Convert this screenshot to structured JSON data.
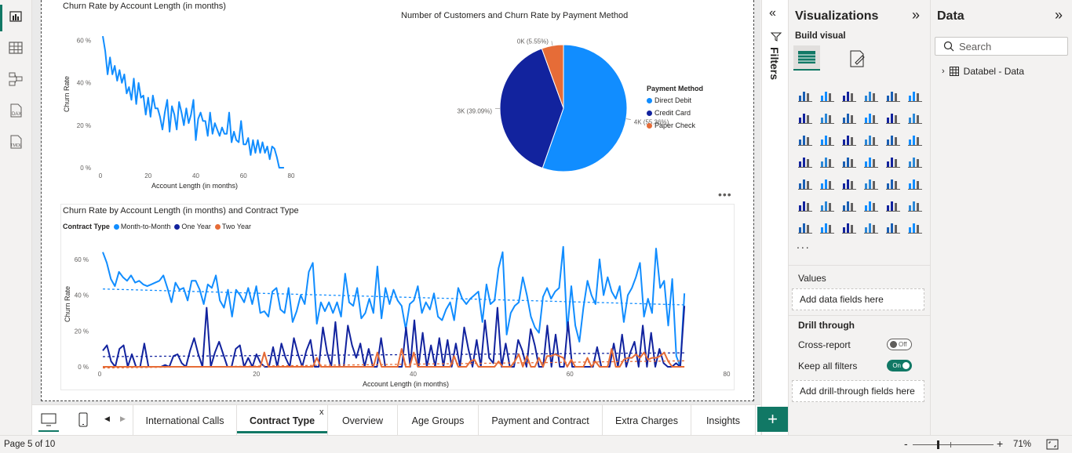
{
  "report": {
    "chart1_title": "Churn Rate by Account Length (in months)",
    "chart2_title": "Number of Customers and Churn Rate by Payment Method",
    "chart3_title": "Churn Rate by Account Length (in months) and Contract Type"
  },
  "chart_data": [
    {
      "type": "line",
      "title": "Churn Rate by Account Length (in months)",
      "xlabel": "Account Length (in months)",
      "ylabel": "Churn Rate",
      "x_ticks": [
        "0",
        "20",
        "40",
        "60",
        "80"
      ],
      "y_ticks": [
        "0 %",
        "20 %",
        "40 %",
        "60 %"
      ],
      "xlim": [
        0,
        80
      ],
      "ylim": [
        0,
        65
      ],
      "series": [
        {
          "values": [
            [
              1,
              62
            ],
            [
              2,
              55
            ],
            [
              3,
              44
            ],
            [
              4,
              52
            ],
            [
              5,
              44
            ],
            [
              6,
              48
            ],
            [
              7,
              41
            ],
            [
              8,
              46
            ],
            [
              9,
              40
            ],
            [
              10,
              44
            ],
            [
              11,
              35
            ],
            [
              12,
              38
            ],
            [
              13,
              32
            ],
            [
              14,
              42
            ],
            [
              15,
              30
            ],
            [
              16,
              40
            ],
            [
              17,
              33
            ],
            [
              18,
              34
            ],
            [
              19,
              25
            ],
            [
              20,
              33
            ],
            [
              21,
              24
            ],
            [
              22,
              34
            ],
            [
              23,
              28
            ],
            [
              24,
              28
            ],
            [
              25,
              24
            ],
            [
              26,
              18
            ],
            [
              27,
              26
            ],
            [
              28,
              32
            ],
            [
              29,
              17
            ],
            [
              30,
              29
            ],
            [
              31,
              25
            ],
            [
              32,
              18
            ],
            [
              33,
              31
            ],
            [
              34,
              26
            ],
            [
              35,
              20
            ],
            [
              36,
              28
            ],
            [
              37,
              21
            ],
            [
              38,
              25
            ],
            [
              39,
              32
            ],
            [
              40,
              13
            ],
            [
              41,
              23
            ],
            [
              42,
              26
            ],
            [
              43,
              22
            ],
            [
              44,
              22
            ],
            [
              45,
              15
            ],
            [
              46,
              26
            ],
            [
              47,
              16
            ],
            [
              48,
              21
            ],
            [
              49,
              18
            ],
            [
              50,
              15
            ],
            [
              51,
              19
            ],
            [
              52,
              16
            ],
            [
              53,
              16
            ],
            [
              54,
              26
            ],
            [
              55,
              12
            ],
            [
              56,
              17
            ],
            [
              57,
              13
            ],
            [
              58,
              12
            ],
            [
              59,
              22
            ],
            [
              60,
              11
            ],
            [
              61,
              11
            ],
            [
              62,
              14
            ],
            [
              63,
              6
            ],
            [
              64,
              13
            ],
            [
              65,
              7
            ],
            [
              66,
              13
            ],
            [
              67,
              7
            ],
            [
              68,
              12
            ],
            [
              69,
              7
            ],
            [
              70,
              10
            ],
            [
              71,
              4
            ],
            [
              72,
              10
            ],
            [
              73,
              9
            ],
            [
              74,
              5
            ],
            [
              75,
              0
            ],
            [
              76,
              0
            ],
            [
              77,
              0
            ]
          ]
        }
      ]
    },
    {
      "type": "pie",
      "title": "Number of Customers and Churn Rate by Payment Method",
      "legend_title": "Payment Method",
      "legend_position": "right",
      "slices": [
        {
          "label": "Direct Debit",
          "value": 55.36,
          "data_label": "4K (55.36%)",
          "color": "#118DFF"
        },
        {
          "label": "Credit Card",
          "value": 39.09,
          "data_label": "3K (39.09%)",
          "color": "#12239E"
        },
        {
          "label": "Paper Check",
          "value": 5.55,
          "data_label": "0K (5.55%)",
          "color": "#E66C37"
        }
      ]
    },
    {
      "type": "line",
      "title": "Churn Rate by Account Length (in months) and Contract Type",
      "legend_title": "Contract Type",
      "legend_position": "top-left",
      "xlabel": "Account Length (in months)",
      "ylabel": "Churn Rate",
      "x_ticks": [
        "0",
        "20",
        "40",
        "60",
        "80"
      ],
      "y_ticks": [
        "0 %",
        "20 %",
        "40 %",
        "60 %"
      ],
      "xlim": [
        0,
        80
      ],
      "ylim": [
        0,
        70
      ],
      "trend_lines": true,
      "series": [
        {
          "name": "Month-to-Month",
          "color": "#118DFF",
          "values": [
            64,
            58,
            49,
            45,
            53,
            50,
            48,
            51,
            47,
            48,
            46,
            45,
            46,
            47,
            48,
            51,
            44,
            36,
            47,
            43,
            44,
            37,
            48,
            48,
            43,
            35,
            46,
            44,
            51,
            37,
            33,
            43,
            28,
            43,
            40,
            36,
            44,
            35,
            45,
            30,
            31,
            28,
            42,
            44,
            32,
            30,
            44,
            25,
            31,
            40,
            35,
            53,
            58,
            24,
            36,
            31,
            36,
            30,
            36,
            28,
            52,
            36,
            34,
            44,
            27,
            30,
            38,
            30,
            56,
            27,
            44,
            35,
            43,
            37,
            34,
            21,
            35,
            37,
            45,
            30,
            36,
            32,
            41,
            28,
            26,
            32,
            36,
            26,
            44,
            38,
            35,
            38,
            40,
            42,
            25,
            46,
            35,
            37,
            55,
            64,
            18,
            30,
            34,
            36,
            50,
            40,
            28,
            22,
            19,
            39,
            44,
            38,
            42,
            44,
            67,
            20,
            45,
            23,
            14,
            33,
            48,
            40,
            35,
            60,
            40,
            50,
            42,
            38,
            45,
            25,
            40,
            44,
            50,
            58,
            28,
            38,
            30,
            66,
            44,
            48,
            23,
            49,
            6,
            0,
            41
          ]
        },
        {
          "name": "One Year",
          "color": "#12239E",
          "values": [
            9,
            12,
            3,
            0,
            10,
            12,
            0,
            7,
            0,
            0,
            13,
            0,
            0,
            0,
            0,
            1,
            0,
            6,
            7,
            2,
            0,
            9,
            16,
            7,
            0,
            33,
            0,
            8,
            14,
            7,
            0,
            0,
            10,
            12,
            0,
            5,
            0,
            7,
            2,
            0,
            0,
            11,
            0,
            13,
            5,
            0,
            16,
            7,
            0,
            9,
            15,
            0,
            0,
            22,
            8,
            0,
            25,
            0,
            0,
            23,
            12,
            5,
            13,
            0,
            10,
            0,
            0,
            16,
            0,
            0,
            0,
            0,
            0,
            22,
            0,
            26,
            0,
            19,
            0,
            12,
            0,
            16,
            0,
            15,
            0,
            13,
            0,
            22,
            10,
            0,
            15,
            0,
            26,
            5,
            2,
            33,
            0,
            13,
            0,
            0,
            15,
            9,
            0,
            21,
            12,
            0,
            0,
            23,
            0,
            18,
            0,
            0,
            25,
            0,
            0,
            0,
            0,
            0,
            0,
            11,
            0,
            0,
            0,
            13,
            0,
            18,
            0,
            8,
            14,
            0,
            23,
            0,
            19,
            0,
            10,
            2,
            0,
            0,
            2,
            0,
            34
          ]
        },
        {
          "name": "Two Year",
          "color": "#E66C37",
          "values": [
            0,
            0,
            0,
            0,
            0,
            0,
            0,
            0,
            0,
            0,
            0,
            0,
            0,
            0,
            0,
            0,
            0,
            0,
            0,
            0,
            0,
            0,
            0,
            0,
            0,
            0,
            0,
            0,
            0,
            0,
            0,
            0,
            0,
            0,
            0,
            0,
            0,
            0,
            0,
            0,
            8,
            0,
            0,
            0,
            0,
            0,
            0,
            0,
            0,
            0,
            0,
            0,
            0,
            5,
            0,
            0,
            0,
            0,
            0,
            0,
            0,
            0,
            0,
            0,
            0,
            0,
            0,
            0,
            8,
            0,
            0,
            0,
            0,
            0,
            10,
            0,
            0,
            8,
            0,
            0,
            0,
            0,
            0,
            0,
            0,
            0,
            0,
            6,
            0,
            0,
            0,
            3,
            4,
            0,
            0,
            0,
            0,
            0,
            3,
            0,
            0,
            0,
            3,
            7,
            0,
            6,
            0,
            0,
            5,
            0,
            6,
            6,
            7,
            6,
            5,
            0,
            4,
            0,
            0,
            0,
            5,
            0,
            3,
            0,
            0,
            0,
            10,
            0,
            0,
            4,
            5,
            5,
            7,
            5,
            8,
            4,
            5,
            5,
            6,
            8,
            3,
            0,
            0,
            0,
            0
          ]
        }
      ]
    }
  ],
  "legend": {
    "pay_title": "Payment Method",
    "pay_direct": "Direct Debit",
    "pay_credit": "Credit Card",
    "pay_paper": "Paper Check",
    "pie_label_direct": "4K (55.36%)",
    "pie_label_credit": "3K (39.09%)",
    "pie_label_paper": "0K (5.55%)",
    "contract_title": "Contract Type",
    "c_m2m": "Month-to-Month",
    "c_one": "One Year",
    "c_two": "Two Year"
  },
  "axes": {
    "xlabel": "Account Length (in months)",
    "ylabel": "Churn Rate",
    "y60": "60 %",
    "y40": "40 %",
    "y20": "20 %",
    "y0": "0 %",
    "x0": "0",
    "x20": "20",
    "x40": "40",
    "x60": "60",
    "x80": "80"
  },
  "filters": {
    "label": "Filters"
  },
  "visualizations": {
    "title": "Visualizations",
    "build_visual": "Build visual",
    "more": "...",
    "values_label": "Values",
    "add_values": "Add data fields here",
    "drill_through": "Drill through",
    "cross_report": "Cross-report",
    "cross_report_state": "Off",
    "keep_filters": "Keep all filters",
    "keep_filters_state": "On",
    "add_drill": "Add drill-through fields here"
  },
  "data_pane": {
    "title": "Data",
    "search_placeholder": "Search",
    "table_name": "Databel - Data"
  },
  "tabs": [
    "International Calls",
    "Contract Type",
    "Overview",
    "Age Groups",
    "Payment and Contract",
    "Extra Charges",
    "Insights"
  ],
  "active_tab_index": 1,
  "status": {
    "page": "Page 5 of 10",
    "zoom": "71%"
  }
}
